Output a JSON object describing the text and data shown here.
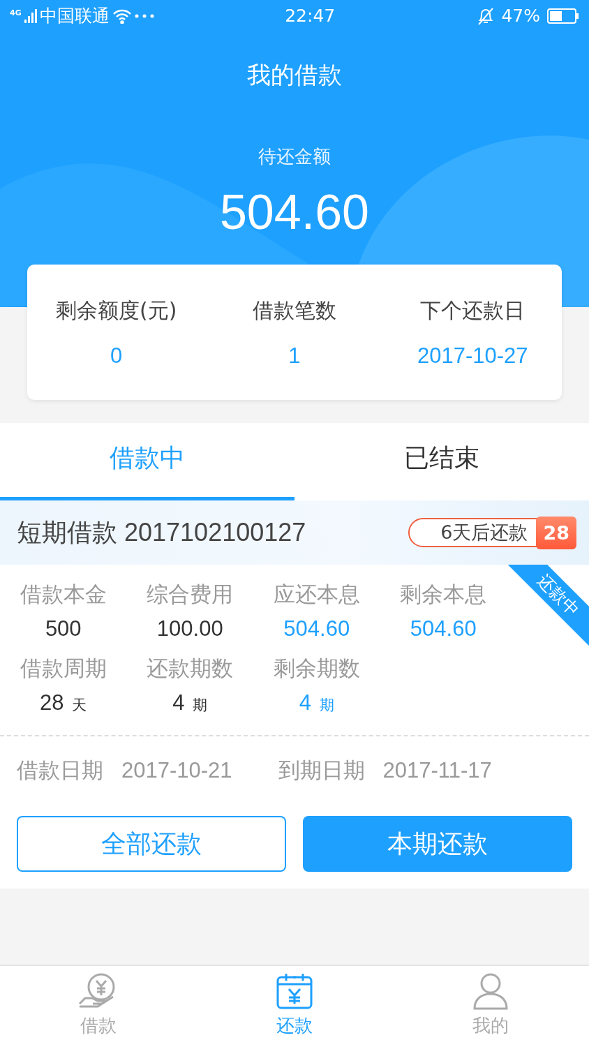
{
  "status_bar": {
    "network": "4G",
    "carrier": "中国联通",
    "time": "22:47",
    "battery": "47%"
  },
  "title": "我的借款",
  "summary": {
    "label": "待还金额",
    "amount": "504.60"
  },
  "stats": [
    {
      "label": "剩余额度(元)",
      "value": "0"
    },
    {
      "label": "借款笔数",
      "value": "1"
    },
    {
      "label": "下个还款日",
      "value": "2017-10-27"
    }
  ],
  "tabs": [
    {
      "label": "借款中",
      "selected": true
    },
    {
      "label": "已结束",
      "selected": false
    }
  ],
  "loan": {
    "title": "短期借款 2017102100127",
    "due_text": "6天后还款",
    "due_day": "28",
    "status": "还款中",
    "fields": [
      {
        "label": "借款本金",
        "value": "500",
        "highlight": false
      },
      {
        "label": "综合费用",
        "value": "100.00",
        "highlight": false
      },
      {
        "label": "应还本息",
        "value": "504.60",
        "highlight": true
      },
      {
        "label": "剩余本息",
        "value": "504.60",
        "highlight": true
      },
      {
        "label": "借款周期",
        "value": "28",
        "unit": "天",
        "highlight": false
      },
      {
        "label": "还款期数",
        "value": "4",
        "unit": "期",
        "highlight": false
      },
      {
        "label": "剩余期数",
        "value": "4",
        "unit": "期",
        "highlight": true
      }
    ],
    "dates": [
      {
        "label": "借款日期",
        "value": "2017-10-21"
      },
      {
        "label": "到期日期",
        "value": "2017-11-17"
      }
    ]
  },
  "buttons": [
    {
      "label": "全部还款",
      "kind": "outline"
    },
    {
      "label": "本期还款",
      "kind": "primary"
    }
  ],
  "nav": [
    {
      "label": "借款",
      "kind": "loan",
      "selected": false
    },
    {
      "label": "还款",
      "kind": "repay",
      "selected": true
    },
    {
      "label": "我的",
      "kind": "user",
      "selected": false
    }
  ]
}
